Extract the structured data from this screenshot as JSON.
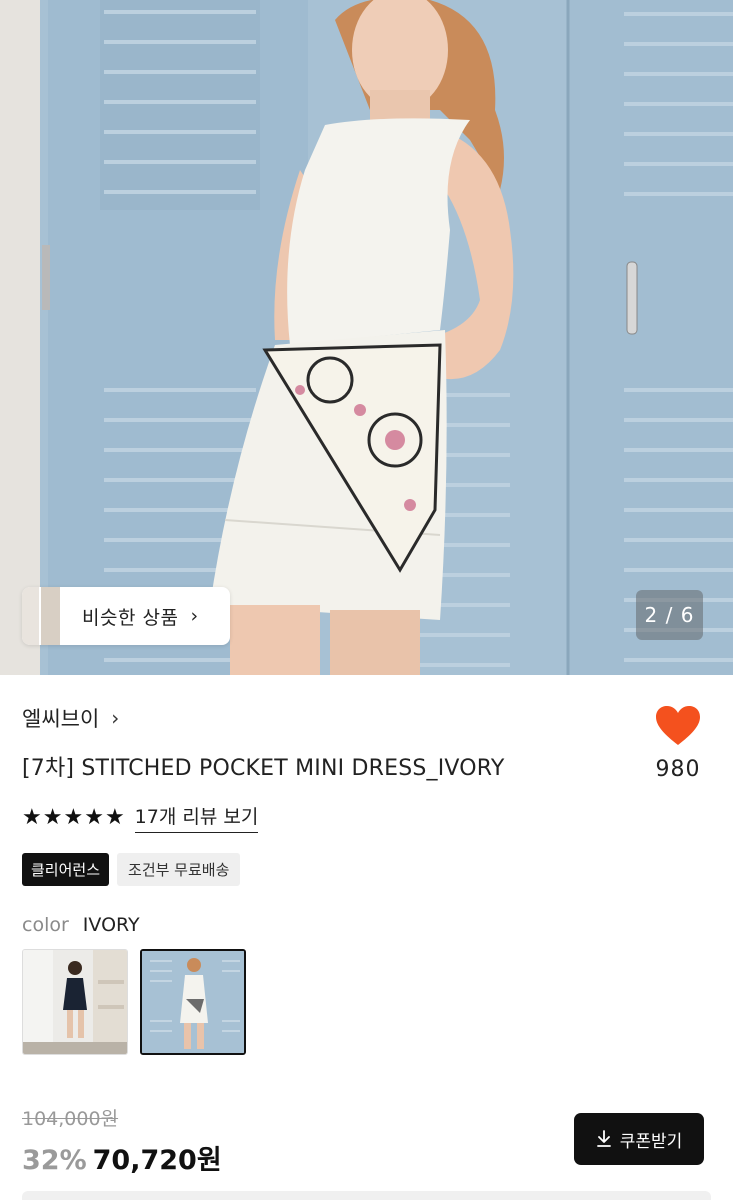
{
  "hero": {
    "similar_button_label": "비슷한 상품",
    "similar_button_chevron": "›",
    "image_counter": "2 / 6"
  },
  "product": {
    "brand": "엘씨브이",
    "brand_chevron": "›",
    "title": "[7차] STITCHED POCKET MINI DRESS_IVORY",
    "like_count": "980",
    "like_icon": "heart-icon",
    "like_color": "#f4511e",
    "rating_stars": 5,
    "review_link": "17개 리뷰 보기",
    "badges": [
      "클리어런스",
      "조건부 무료배송"
    ],
    "color_key": "color",
    "color_value": "IVORY",
    "swatches": [
      "navy-dress-thumbnail",
      "ivory-dress-thumbnail"
    ],
    "selected_swatch_index": 1
  },
  "pricing": {
    "original_price": "104,000원",
    "discount": "32%",
    "price": "70,720원",
    "coupon_label": "쿠폰받기",
    "coupon_icon": "download-icon"
  }
}
